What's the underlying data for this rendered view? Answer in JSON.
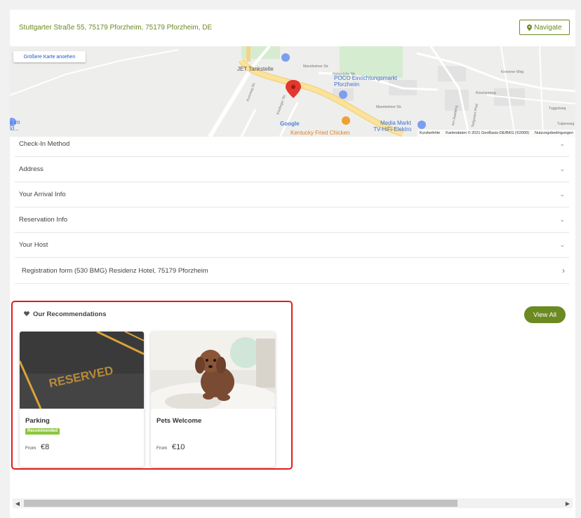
{
  "address": {
    "text": "Stuttgarter Straße 55, 75179 Pforzheim, 75179 Pforzheim, DE",
    "navigate_label": "Navigate"
  },
  "map": {
    "bigger_map_label": "Größere Karte ansehen",
    "labels": {
      "jet": "JET Tankstelle",
      "poco_line1": "POCO Einrichtungsmarkt",
      "poco_line2": "Pforzheim",
      "media_line1": "Media Markt",
      "media_line2": "TV-HiFi-Elektro",
      "kfc": "Kentucky Fried Chicken",
      "google": "Google",
      "edge_line1": "s im",
      "edge_line2": "ld..."
    },
    "streets": [
      "Mannheimer Str.",
      "Hohenlohe Str.",
      "Kurzweg Str.",
      "Kisslinger Str.",
      "Mannheimer Str.",
      "Kronnner Weg",
      "Kirschenweg",
      "Tiefgarten Pfad",
      "Am Rastberg",
      "Tuggelweg",
      "Tulpenweg"
    ],
    "footer": [
      "Kurzbefehle",
      "Kartendaten © 2021 GeoBasis-DE/BKG (©2009)",
      "Nutzungsbedingungen"
    ]
  },
  "accordion": [
    {
      "label": "Check-In Method"
    },
    {
      "label": "Address"
    },
    {
      "label": "Your Arrival Info"
    },
    {
      "label": "Reservation Info"
    },
    {
      "label": "Your Host"
    }
  ],
  "registration_label": "Registration form (530 BMG) Residenz Hotel, 75179 Pforzheim",
  "recommendations": {
    "title": "Our Recommendations",
    "view_all": "View All",
    "cards": [
      {
        "title": "Parking",
        "badge": "Recommended",
        "from": "From",
        "price": "€8",
        "image_text": "RESERVED"
      },
      {
        "title": "Pets Welcome",
        "from": "From",
        "price": "€10"
      }
    ]
  },
  "colors": {
    "accent": "#6b8a21",
    "badge": "#8cc63f",
    "highlight": "#e31a1a"
  },
  "icons": [
    "map-pin-icon",
    "heart-icon",
    "chevron-down-icon",
    "chevron-right-icon",
    "scroll-left-icon",
    "scroll-right-icon"
  ]
}
